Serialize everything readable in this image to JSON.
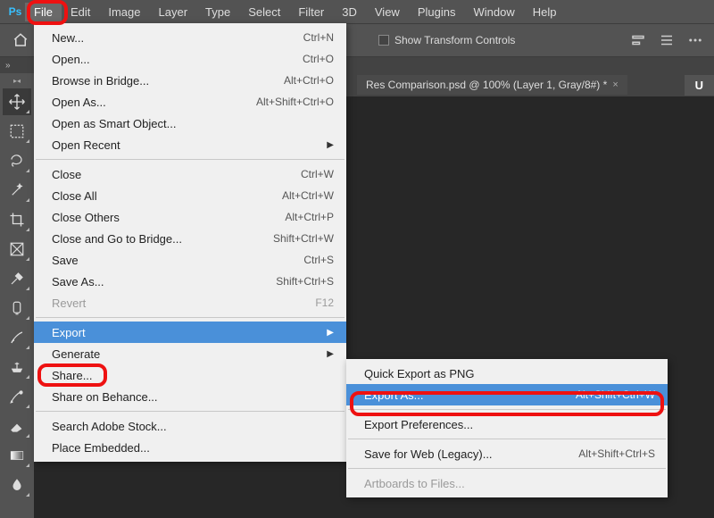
{
  "app": {
    "logo": "Ps",
    "menus": [
      "File",
      "Edit",
      "Image",
      "Layer",
      "Type",
      "Select",
      "Filter",
      "3D",
      "View",
      "Plugins",
      "Window",
      "Help"
    ],
    "active_menu_index": 0
  },
  "options_bar": {
    "show_transform_label": "Show Transform Controls"
  },
  "doc_tab": {
    "title": "Res Comparison.psd @ 100% (Layer 1, Gray/8#) *",
    "right_label": "U"
  },
  "file_menu": [
    {
      "type": "item",
      "label": "New...",
      "shortcut": "Ctrl+N"
    },
    {
      "type": "item",
      "label": "Open...",
      "shortcut": "Ctrl+O"
    },
    {
      "type": "item",
      "label": "Browse in Bridge...",
      "shortcut": "Alt+Ctrl+O"
    },
    {
      "type": "item",
      "label": "Open As...",
      "shortcut": "Alt+Shift+Ctrl+O"
    },
    {
      "type": "item",
      "label": "Open as Smart Object..."
    },
    {
      "type": "item",
      "label": "Open Recent",
      "submenu": true
    },
    {
      "type": "sep"
    },
    {
      "type": "item",
      "label": "Close",
      "shortcut": "Ctrl+W"
    },
    {
      "type": "item",
      "label": "Close All",
      "shortcut": "Alt+Ctrl+W"
    },
    {
      "type": "item",
      "label": "Close Others",
      "shortcut": "Alt+Ctrl+P"
    },
    {
      "type": "item",
      "label": "Close and Go to Bridge...",
      "shortcut": "Shift+Ctrl+W"
    },
    {
      "type": "item",
      "label": "Save",
      "shortcut": "Ctrl+S"
    },
    {
      "type": "item",
      "label": "Save As...",
      "shortcut": "Shift+Ctrl+S"
    },
    {
      "type": "item",
      "label": "Revert",
      "shortcut": "F12",
      "disabled": true
    },
    {
      "type": "sep"
    },
    {
      "type": "item",
      "label": "Export",
      "submenu": true,
      "hover": true
    },
    {
      "type": "item",
      "label": "Generate",
      "submenu": true
    },
    {
      "type": "item",
      "label": "Share..."
    },
    {
      "type": "item",
      "label": "Share on Behance..."
    },
    {
      "type": "sep"
    },
    {
      "type": "item",
      "label": "Search Adobe Stock..."
    },
    {
      "type": "item",
      "label": "Place Embedded..."
    }
  ],
  "export_submenu": [
    {
      "type": "item",
      "label": "Quick Export as PNG"
    },
    {
      "type": "item",
      "label": "Export As...",
      "shortcut": "Alt+Shift+Ctrl+W",
      "hover": true
    },
    {
      "type": "sep"
    },
    {
      "type": "item",
      "label": "Export Preferences..."
    },
    {
      "type": "sep"
    },
    {
      "type": "item",
      "label": "Save for Web (Legacy)...",
      "shortcut": "Alt+Shift+Ctrl+S"
    },
    {
      "type": "sep"
    },
    {
      "type": "item",
      "label": "Artboards to Files...",
      "disabled": true
    }
  ],
  "chevron": "»"
}
